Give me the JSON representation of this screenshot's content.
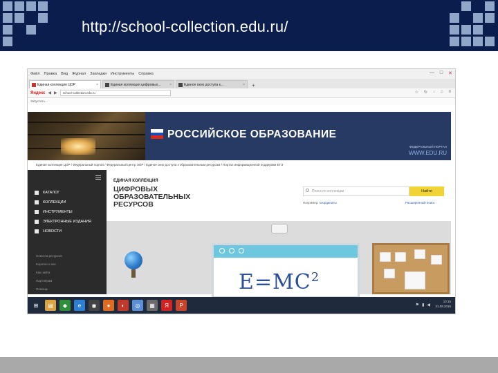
{
  "slide": {
    "url_title": "http://school-collection.edu.ru/"
  },
  "browser": {
    "menu": [
      "Файл",
      "Правка",
      "Вид",
      "Журнал",
      "Закладки",
      "Инструменты",
      "Справка"
    ],
    "window_controls": [
      "—",
      "□",
      "✕"
    ],
    "tabs": [
      {
        "label": "Единая коллекция ЦОР",
        "active": true
      },
      {
        "label": "Единая коллекция цифровых...",
        "active": false
      },
      {
        "label": "Единое окно доступа к...",
        "active": false
      }
    ],
    "new_tab": "+",
    "yandex_label": "Яндекс",
    "address": "school-collection.edu.ru",
    "bookmarks_label": "Запустить..."
  },
  "banner": {
    "title": "РОССИЙСКОЕ ОБРАЗОВАНИЕ",
    "site_name": "ФЕДЕРАЛЬНЫЙ ПОРТАЛ",
    "site_url": "WWW.EDU.RU",
    "flag_colors": [
      "#ffffff",
      "#1f4fb5",
      "#d52b1e"
    ]
  },
  "site": {
    "breadcrumb": "Единая коллекция ЦОР  /  Федеральный портал  /  Федеральный центр ЭОР  /  Единое окно доступа к образовательным ресурсам  /  Портал информационной поддержки ЕГЭ",
    "subtitle": "ЕДИНАЯ КОЛЛЕКЦИЯ",
    "title": "ЦИФРОВЫХ ОБРАЗОВАТЕЛЬНЫХ РЕСУРСОВ",
    "search_placeholder": "Поиск по коллекции",
    "search_button": "Найти",
    "example_label": "Например:",
    "example_link": "координаты",
    "advanced_search": "Расширенный поиск"
  },
  "sidebar": {
    "items": [
      {
        "label": "КАТАЛОГ"
      },
      {
        "label": "КОЛЛЕКЦИИ"
      },
      {
        "label": "ИНСТРУМЕНТЫ"
      },
      {
        "label": "ЭЛЕКТРОННЫЕ ИЗДАНИЯ"
      },
      {
        "label": "НОВОСТИ"
      }
    ],
    "links": [
      "Новости ресурсов",
      "Коротко о нас",
      "Как найти",
      "Партнёрам",
      "Помощь"
    ]
  },
  "classroom": {
    "formula": "E=MC",
    "formula_power": "2"
  },
  "taskbar": {
    "time": "10:15",
    "date": "21.09.2015",
    "icons": [
      {
        "name": "windows-start-icon",
        "glyph": "⊞",
        "color": "#1f2a3c"
      },
      {
        "name": "explorer-icon",
        "glyph": "▤",
        "color": "#d9a441"
      },
      {
        "name": "store-icon",
        "glyph": "◆",
        "color": "#2f8f3a"
      },
      {
        "name": "ie-icon",
        "glyph": "e",
        "color": "#2d7fd3"
      },
      {
        "name": "media-icon",
        "glyph": "◉",
        "color": "#444444"
      },
      {
        "name": "firefox-icon",
        "glyph": "●",
        "color": "#e06a1f"
      },
      {
        "name": "app-icon",
        "glyph": "◐",
        "color": "#c0392b"
      },
      {
        "name": "globe-icon",
        "glyph": "◎",
        "color": "#5b8fd6"
      },
      {
        "name": "photo-icon",
        "glyph": "▦",
        "color": "#6b6b6b"
      },
      {
        "name": "yandex-icon",
        "glyph": "Я",
        "color": "#d32222"
      },
      {
        "name": "powerpoint-icon",
        "glyph": "P",
        "color": "#c8452b"
      }
    ]
  }
}
